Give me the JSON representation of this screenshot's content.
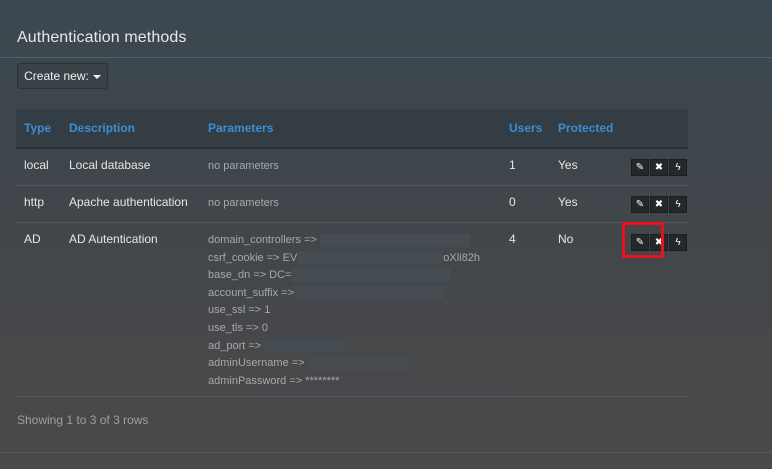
{
  "page": {
    "title": "Authentication methods"
  },
  "toolbar": {
    "create_label": "Create new:",
    "create_icon": "caret-down-icon"
  },
  "table": {
    "headers": {
      "type": "Type",
      "description": "Description",
      "parameters": "Parameters",
      "users": "Users",
      "protected": "Protected"
    },
    "header_color": "#3c8ed3",
    "rows": [
      {
        "type": "local",
        "description": "Local database",
        "parameters": [
          "no parameters"
        ],
        "users": "1",
        "protected": "Yes"
      },
      {
        "type": "http",
        "description": "Apache authentication",
        "parameters": [
          "no parameters"
        ],
        "users": "0",
        "protected": "Yes"
      },
      {
        "type": "AD",
        "description": "AD Autentication",
        "parameters": [
          "domain_controllers =>",
          "csrf_cookie => EV",
          "base_dn => DC=",
          "account_suffix =>",
          "use_ssl => 1",
          "use_tls => 0",
          "ad_port =>",
          "adminUsername =>",
          "adminPassword => ********"
        ],
        "csrf_suffix": "oXli82h",
        "users": "4",
        "protected": "No"
      }
    ],
    "actions": {
      "edit_icon": "pencil-icon",
      "delete_icon": "times-icon",
      "test_icon": "bolt-icon"
    }
  },
  "highlight_color": "#e5141c",
  "footer": {
    "status": "Showing 1 to 3 of 3 rows"
  }
}
